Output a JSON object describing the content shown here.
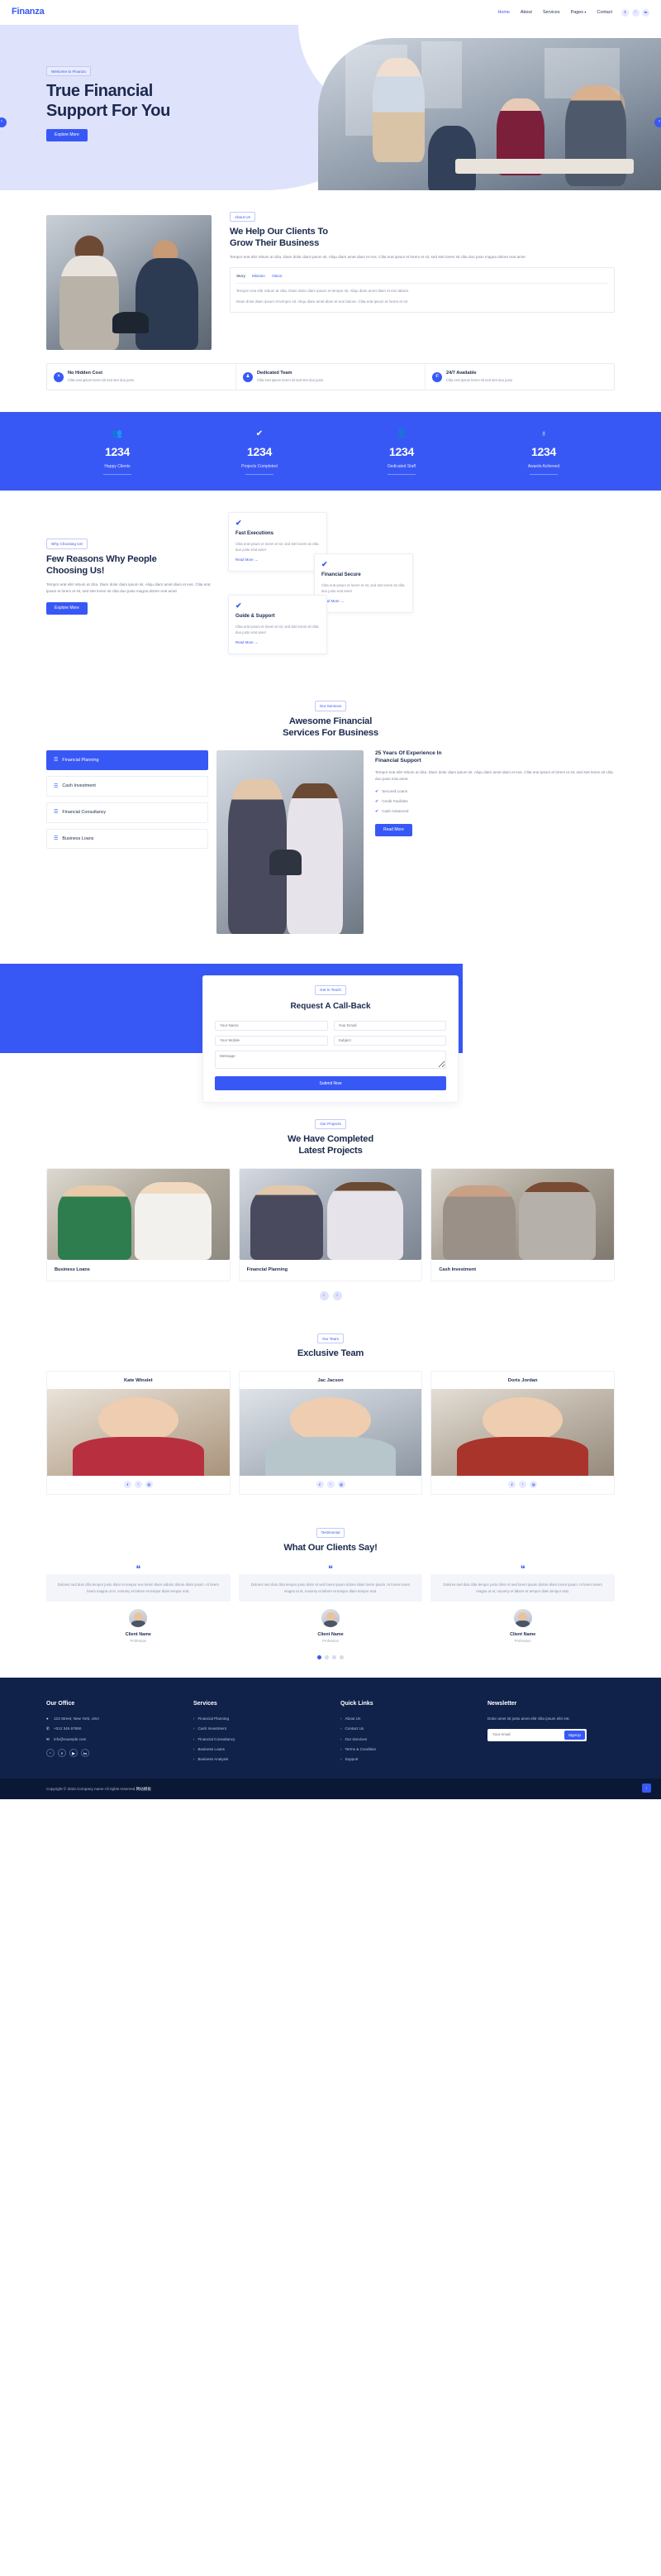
{
  "brand": {
    "name": "Finanza",
    "accent": "#3858f6",
    "dark": "#1b2a4e",
    "footer_bg": "#10224a"
  },
  "nav": {
    "links": [
      {
        "label": "Home",
        "active": true
      },
      {
        "label": "About",
        "active": false
      },
      {
        "label": "Services",
        "active": false
      },
      {
        "label": "Pages",
        "active": false,
        "dropdown": true
      },
      {
        "label": "Contact",
        "active": false
      }
    ],
    "social": [
      {
        "name": "facebook-icon",
        "glyph": "f"
      },
      {
        "name": "twitter-icon",
        "glyph": "ᵛ"
      },
      {
        "name": "linkedin-icon",
        "glyph": "in"
      }
    ]
  },
  "hero": {
    "badge": "Welcome to Finanza",
    "title_line1": "True Financial",
    "title_line2": "Support For You",
    "cta": "Explore More",
    "prev_icon": "‹",
    "next_icon": "›"
  },
  "about": {
    "badge": "About Us",
    "title_line1": "We Help Our Clients To",
    "title_line2": "Grow Their Business",
    "paragraph": "Tempor erat elitr rebum at clita. Diam dolor diam ipsum sit. Aliqu diam amet diam et eos. Clita erat ipsum et lorem et sit, sed stet lorem sit clita duo justo magna dolore erat amet",
    "tabs": [
      {
        "label": "Story",
        "active": true
      },
      {
        "label": "Mission",
        "active": false
      },
      {
        "label": "Vision",
        "active": false
      }
    ],
    "tab_body_1": "Tempor erat elitr rebum at clita. Diam dolor diam ipsum et tempor sit. Aliqu diam amet diam et eos labore.",
    "tab_body_2": "Diam dolor diam ipsum et tempor sit. Aliqu diam amet diam et eos labore. Clita erat ipsum et lorem et sit",
    "features": [
      {
        "icon": "✕",
        "icon_name": "no-cost-icon",
        "title": "No Hidden Cost",
        "sub": "Clita erat ipsum lorem sit sed stet duo justo"
      },
      {
        "icon": "♟",
        "icon_name": "team-icon",
        "title": "Dedicated Team",
        "sub": "Clita erat ipsum lorem sit sed stet duo justo"
      },
      {
        "icon": "✆",
        "icon_name": "phone-icon",
        "title": "24/7 Available",
        "sub": "Clita erat ipsum lorem sit sed stet duo justo"
      }
    ]
  },
  "stats": [
    {
      "icon": "👥",
      "icon_name": "people-icon",
      "number": "1234",
      "label": "Happy Clients"
    },
    {
      "icon": "✔",
      "icon_name": "check-icon",
      "number": "1234",
      "label": "Projects Completed"
    },
    {
      "icon": "👤",
      "icon_name": "staff-icon",
      "number": "1234",
      "label": "Dedicated Staff"
    },
    {
      "icon": "♁",
      "icon_name": "award-icon",
      "number": "1234",
      "label": "Awards Achieved"
    }
  ],
  "why": {
    "badge": "Why Choosing Us!",
    "title_line1": "Few Reasons Why People",
    "title_line2": "Choosing Us!",
    "paragraph": "Tempor erat elitr rebum at clita. Diam dolor diam ipsum sit. Aliqu diam amet diam et eos. Clita erat ipsum et lorem et sit, sed stet lorem sit clita duo justo magna dolore erat amet",
    "cta": "Explore More",
    "cards": [
      {
        "icon": "✔",
        "title": "Fast Executions",
        "text": "Clita erat ipsum et lorem et sit, sed stet lorem sit clita duo justo erat amet",
        "link": "Read More  →"
      },
      {
        "icon": "✔",
        "title": "Financial Secure",
        "text": "Clita erat ipsum et lorem et sit, sed stet lorem sit clita duo justo erat amet",
        "link": "Read More  →"
      },
      {
        "icon": "✔",
        "title": "Guide & Support",
        "text": "Clita erat ipsum et lorem et sit, sed stet lorem sit clita duo justo erat amet",
        "link": "Read More  →"
      }
    ]
  },
  "services": {
    "badge": "Our Services",
    "title_line1": "Awesome Financial",
    "title_line2": "Services For Business",
    "tabs": [
      {
        "label": "Financial Planning",
        "active": true
      },
      {
        "label": "Cash Investment",
        "active": false
      },
      {
        "label": "Financial Consultancy",
        "active": false
      },
      {
        "label": "Business Loans",
        "active": false
      }
    ],
    "panel": {
      "title_line1": "25 Years Of Experience In",
      "title_line2": "Financial Support",
      "paragraph": "Tempor erat elitr rebum at clita. Diam dolor diam ipsum sit. Aliqu diam amet diam et eos. Clita erat ipsum et lorem et sit, sed stet lorem sit clita duo justo erat amet.",
      "checks": [
        "Secured Loans",
        "Credit Facilities",
        "Cash Advanced"
      ],
      "cta": "Read More"
    }
  },
  "callback": {
    "badge": "Get In Touch",
    "title": "Request A Call-Back",
    "fields": {
      "name": "Your Name",
      "email": "Your Email",
      "mobile": "Your Mobile",
      "subject": "Subject",
      "message": "Message"
    },
    "submit": "Submit Now"
  },
  "projects": {
    "badge": "Our Projects",
    "title_line1": "We Have Completed",
    "title_line2": "Latest Projects",
    "items": [
      {
        "caption": "Business Loans"
      },
      {
        "caption": "Financial Planning"
      },
      {
        "caption": "Cash Investment"
      }
    ],
    "prev_icon": "‹",
    "next_icon": "›"
  },
  "team": {
    "badge": "Our Team",
    "title": "Exclusive Team",
    "members": [
      {
        "name": "Kate Winslet"
      },
      {
        "name": "Jac Jacson"
      },
      {
        "name": "Doris Jordan"
      }
    ],
    "social": [
      {
        "name": "facebook-icon",
        "glyph": "f"
      },
      {
        "name": "twitter-icon",
        "glyph": "ᵛ"
      },
      {
        "name": "instagram-icon",
        "glyph": "◎"
      }
    ]
  },
  "testimonial": {
    "badge": "Testimonial",
    "title": "What Our Clients Say!",
    "quote_glyph": "❝",
    "items": [
      {
        "text": "Dolores sed duis clita tempor justo dolor et tempor eos lorem diam utdolor dolore diam ipsum. At lorem lorem magna ut et, nonumy et labore et tempor diam tempor erat.",
        "name": "Client Name",
        "role": "Profession"
      },
      {
        "text": "Dolores sed duis clita tempor justo dolor et sed lorem ipsum dolore diam lorem ipsum. At lorem lorem magna ut et, nonumy et labore et tempor diam tempor erat.",
        "name": "Client Name",
        "role": "Profession"
      },
      {
        "text": "Dolores sed duis clita tempor justo dolor et sed lorem ipsum dolore diam lorem ipsum. At lorem lorem magna ut et, nonumy et labore et tempor diam tempor erat.",
        "name": "Client Name",
        "role": "Profession"
      }
    ],
    "pager": [
      true,
      false,
      false,
      false
    ]
  },
  "footer": {
    "office": {
      "heading": "Our Office",
      "address": "123 Street, New York, USA",
      "phone": "+012 345 67890",
      "email": "info@example.com",
      "address_icon": "⌖",
      "phone_icon": "✆",
      "email_icon": "✉",
      "social": [
        {
          "name": "twitter-icon",
          "glyph": "ᵛ"
        },
        {
          "name": "facebook-icon",
          "glyph": "f"
        },
        {
          "name": "youtube-icon",
          "glyph": "▶"
        },
        {
          "name": "linkedin-icon",
          "glyph": "in"
        }
      ]
    },
    "services": {
      "heading": "Services",
      "links": [
        "Financial Planning",
        "Cash Investment",
        "Financial Consultancy",
        "Business Loans",
        "Business Analysis"
      ]
    },
    "quick": {
      "heading": "Quick Links",
      "links": [
        "About Us",
        "Contact Us",
        "Our Services",
        "Terms & Condition",
        "Support"
      ]
    },
    "newsletter": {
      "heading": "Newsletter",
      "text": "Dolor amet sit justo amet elitr clita ipsum elitr est.",
      "placeholder": "Your email",
      "button": "SignUp"
    },
    "copyright": "Copyright © 2022.Company name All rights reserved.",
    "copyright_hl": "网站模板",
    "to_top_icon": "↑"
  }
}
